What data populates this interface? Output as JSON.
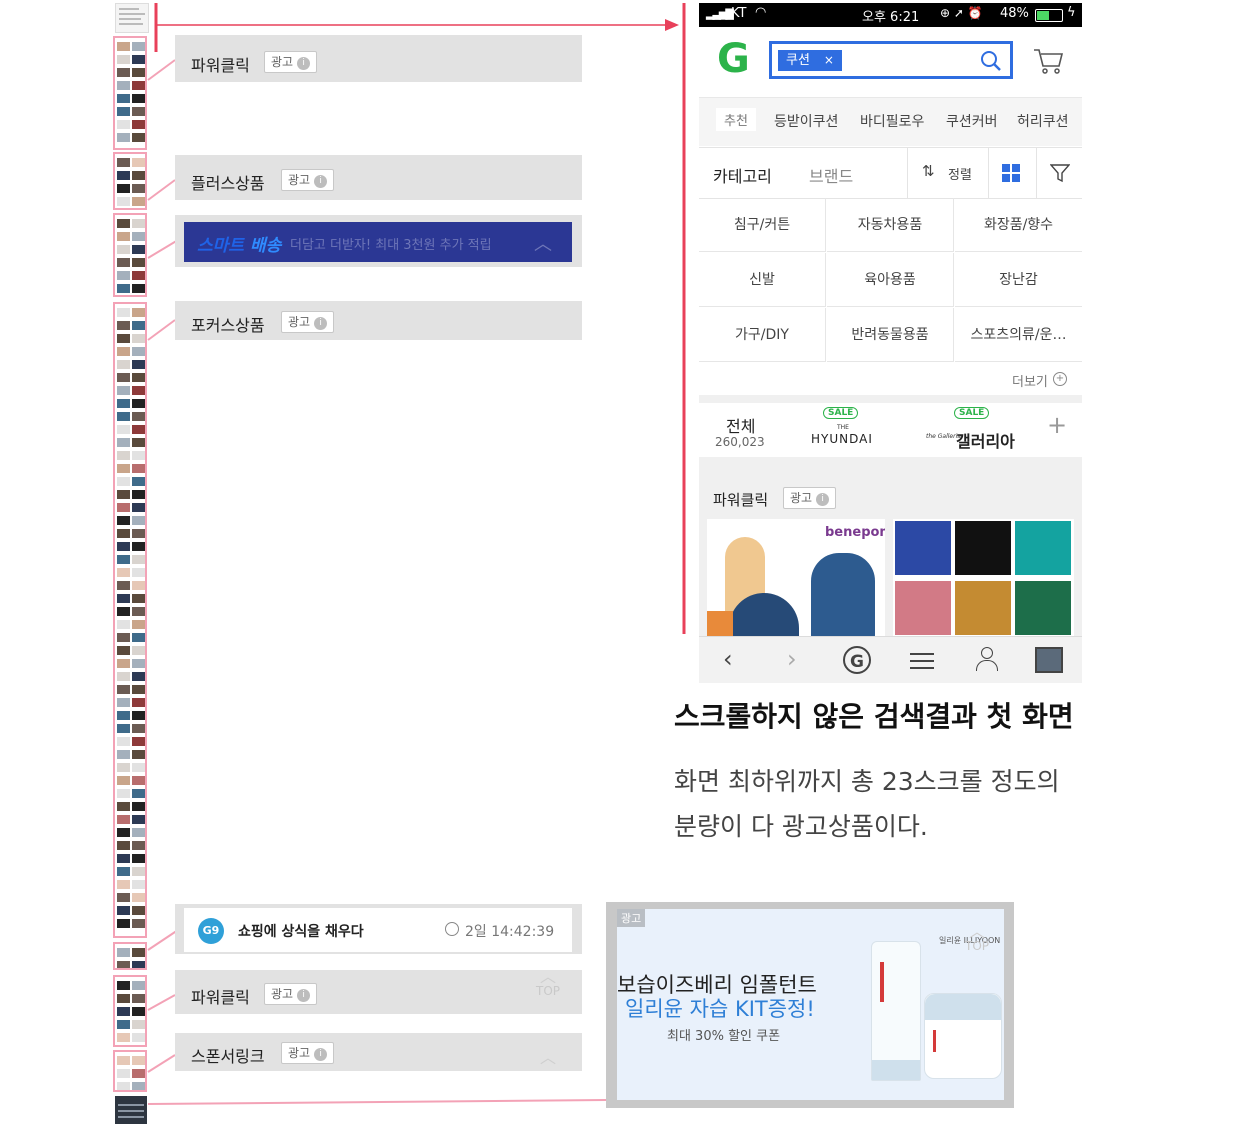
{
  "callouts": {
    "power_click": "파워클릭",
    "plus_product": "플러스상품",
    "focus_product": "포커스상품",
    "power_click_2": "파워클릭",
    "sponsor_link": "스폰서링크",
    "ad_badge": "광고",
    "info_glyph": "i",
    "top_label": "TOP"
  },
  "smart_banner": {
    "logo_part1": "스마트",
    "logo_part2": "배송",
    "text": "더담고 더받자! 최대 3천원 추가 적립"
  },
  "phone": {
    "status": {
      "carrier": "KT",
      "time": "오후 6:21",
      "battery": "48%"
    },
    "logo": "G",
    "search_chip": "쿠션",
    "chip_close": "×",
    "keywords": [
      "추천",
      "등받이쿠션",
      "바디필로우",
      "쿠션커버",
      "허리쿠션"
    ],
    "filter": {
      "category": "카테고리",
      "brand": "브랜드",
      "sort": "정렬"
    },
    "categories": [
      "침구/커튼",
      "자동차용품",
      "화장품/향수",
      "신발",
      "육아용품",
      "장난감",
      "가구/DIY",
      "반려동물용품",
      "스포츠의류/운…"
    ],
    "more": "더보기",
    "mall_tabs": {
      "all_label": "전체",
      "all_count": "260,023",
      "sale_badge": "SALE",
      "hyundai_the": "THE",
      "hyundai": "HYUNDAI",
      "galleria_script": "the Galleria",
      "galleria": "갤러리아",
      "plus": "+"
    },
    "power_click": "파워클릭",
    "ad_badge": "광고",
    "benepom": "benepom"
  },
  "caption": {
    "title": "스크롤하지 않은 검색결과 첫 화면",
    "line1": "화면 최하위까지 총 23스크롤 정도의",
    "line2": "분량이 다 광고상품이다."
  },
  "g9_bar": {
    "logo": "G9",
    "text": "쇼핑에 상식을 채우다",
    "time": "2일 14:42:39"
  },
  "ad_banner": {
    "tag": "광고",
    "line1": "보습이즈베리 임폴턴트",
    "line2": "일리윤 자습 KIT증정!",
    "line3": "최대 30% 할인 쿠폰",
    "brand": "일리윤 ILLIYOON",
    "top": "TOP"
  },
  "colors": {
    "pink_line": "#f3a2b6",
    "red_line": "#e8405a",
    "brand_green": "#2cb34a",
    "search_blue": "#2f6de0",
    "g9_blue": "#2fa0d8"
  }
}
